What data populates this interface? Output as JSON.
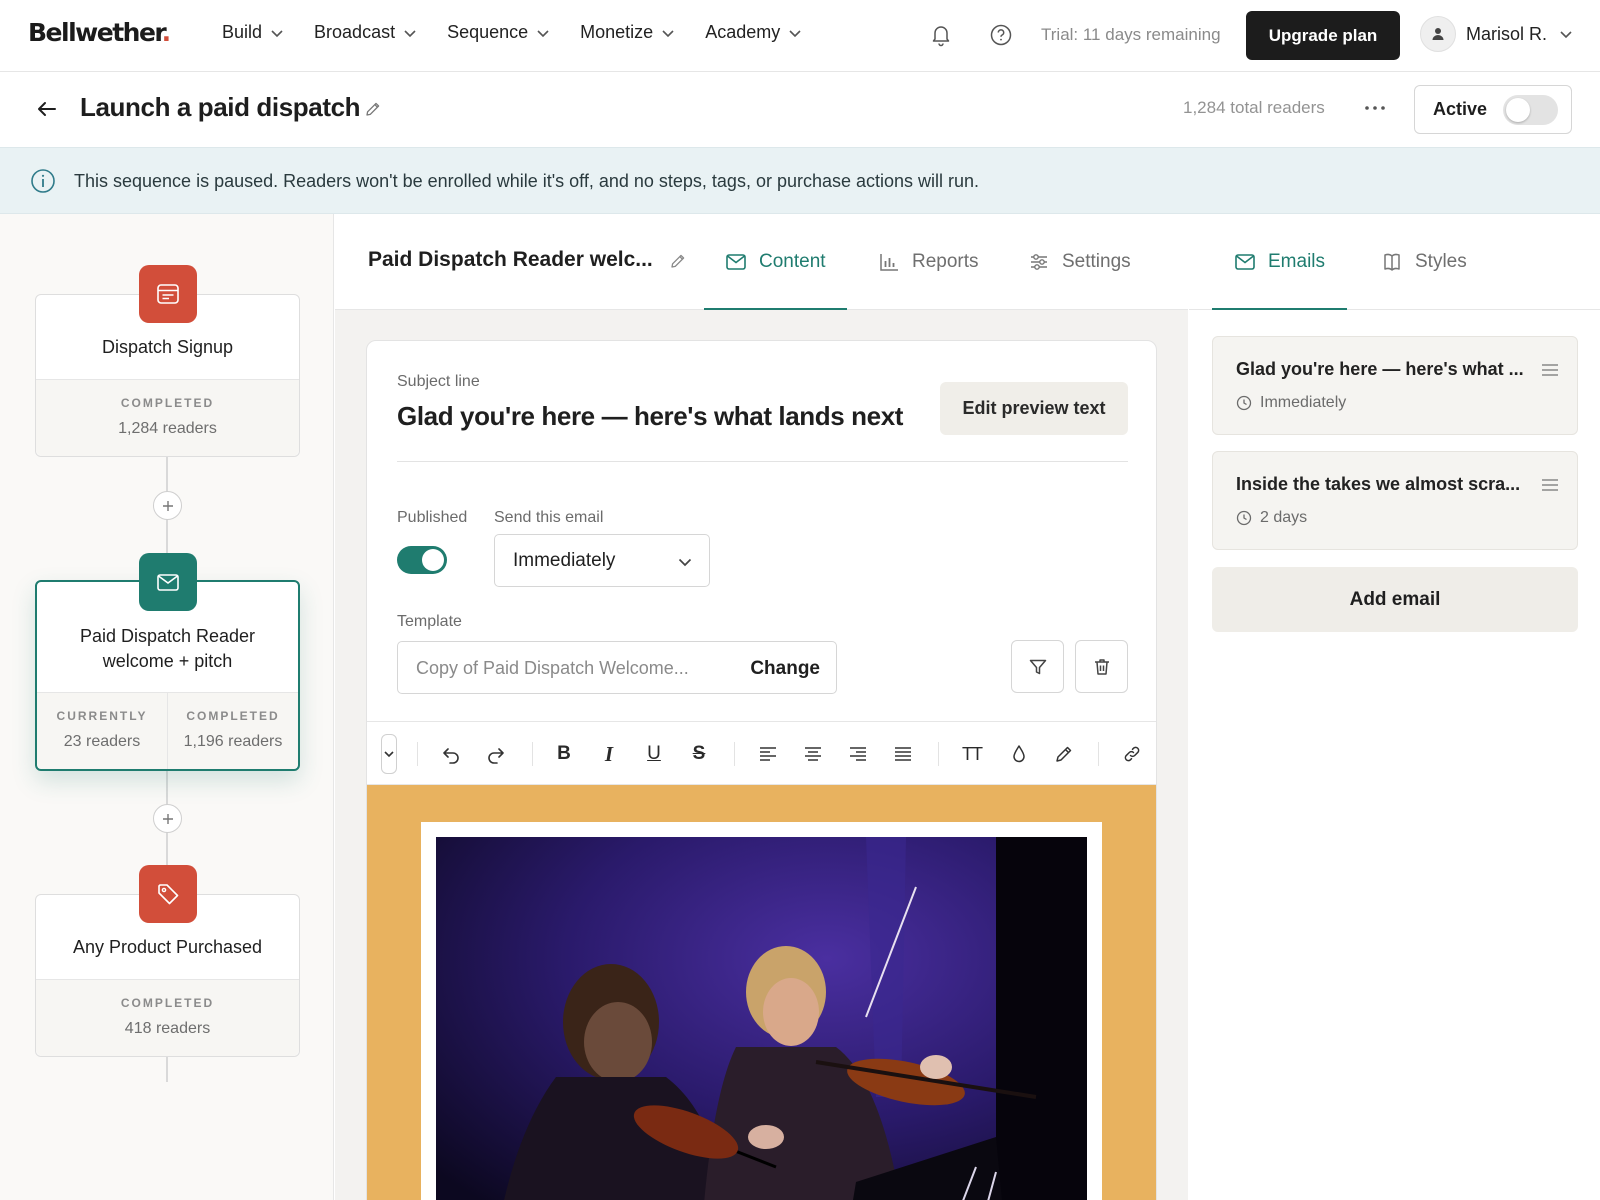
{
  "brand": {
    "name": "Bellwether",
    "dot": ".",
    "accent": "#d24e3a"
  },
  "nav": {
    "items": [
      {
        "label": "Build"
      },
      {
        "label": "Broadcast"
      },
      {
        "label": "Sequence"
      },
      {
        "label": "Monetize"
      },
      {
        "label": "Academy"
      }
    ],
    "icons": [
      "bell-icon",
      "help-icon"
    ],
    "trial_text": "Trial: 11 days remaining",
    "upgrade_label": "Upgrade plan",
    "user_name": "Marisol R."
  },
  "page": {
    "title": "Launch a paid dispatch",
    "total_readers": "1,284 total readers",
    "active_label": "Active",
    "active_on": false
  },
  "banner": {
    "message": "This sequence is paused. Readers won't be enrolled while it's off, and no steps, tags, or purchase actions will run."
  },
  "flow": {
    "nodes": [
      {
        "title": "Dispatch Signup",
        "type": "form",
        "stats": [
          {
            "label": "COMPLETED",
            "value": "1,284 readers"
          }
        ]
      },
      {
        "title": "Paid Dispatch Reader welcome + pitch",
        "type": "email",
        "selected": true,
        "stats": [
          {
            "label": "CURRENTLY",
            "value": "23 readers"
          },
          {
            "label": "COMPLETED",
            "value": "1,196 readers"
          }
        ]
      },
      {
        "title": "Any Product Purchased",
        "type": "tag",
        "stats": [
          {
            "label": "COMPLETED",
            "value": "418 readers"
          }
        ]
      }
    ],
    "colors": {
      "node_red": "#d24e3a",
      "node_teal": "#1f7c6f"
    }
  },
  "editor": {
    "sequence_name": "Paid Dispatch Reader welc...",
    "tabs": [
      {
        "label": "Content",
        "icon": "mail-icon",
        "active": true
      },
      {
        "label": "Reports",
        "icon": "bar-chart-icon",
        "active": false
      },
      {
        "label": "Settings",
        "icon": "sliders-icon",
        "active": false
      }
    ],
    "subject_label": "Subject line",
    "subject": "Glad you're here — here's what lands next",
    "edit_preview_label": "Edit preview text",
    "published_label": "Published",
    "published": true,
    "send_label": "Send this email",
    "send_value": "Immediately",
    "template_label": "Template",
    "template_value": "Copy of Paid Dispatch Welcome...",
    "template_change": "Change",
    "toolbar_icons": [
      "collapse-icon",
      "undo-icon",
      "redo-icon",
      "bold-icon",
      "italic-icon",
      "underline-icon",
      "strikethrough-icon",
      "align-left-icon",
      "align-center-icon",
      "align-right-icon",
      "justify-icon",
      "text-size-icon",
      "text-color-icon",
      "highlight-icon",
      "link-icon"
    ],
    "toolbar_glyphs": {
      "bold": "B",
      "italic": "I",
      "underline": "U",
      "strike": "S",
      "textsize": "TT"
    },
    "canvas_color": "#e8b25f"
  },
  "emails_panel": {
    "tabs": [
      {
        "label": "Emails",
        "icon": "mail-icon",
        "active": true
      },
      {
        "label": "Styles",
        "icon": "book-icon",
        "active": false
      }
    ],
    "emails": [
      {
        "title": "Glad you're here — here's what ...",
        "timing": "Immediately"
      },
      {
        "title": "Inside the takes we almost scra...",
        "timing": "2 days"
      }
    ],
    "add_label": "Add email"
  }
}
